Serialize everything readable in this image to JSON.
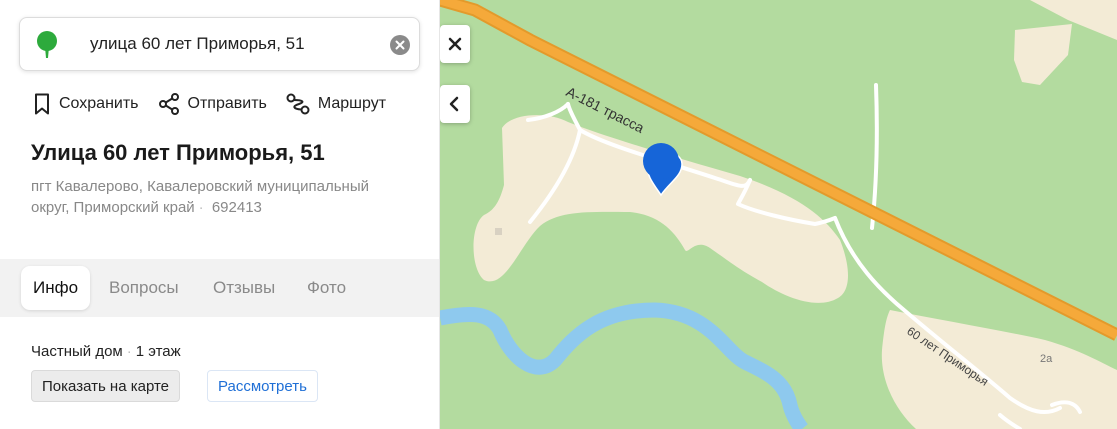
{
  "search": {
    "query": "улица 60 лет Приморья, 51"
  },
  "actions": {
    "save_label": "Сохранить",
    "share_label": "Отправить",
    "route_label": "Маршрут"
  },
  "place": {
    "title": "Улица 60 лет Приморья, 51",
    "address_line": "пгт Кавалерово, Кавалеровский муниципальный округ, Приморский край",
    "postcode": "692413"
  },
  "tabs": [
    {
      "label": "Инфо",
      "active": true
    },
    {
      "label": "Вопросы",
      "active": false
    },
    {
      "label": "Отзывы",
      "active": false
    },
    {
      "label": "Фото",
      "active": false
    }
  ],
  "details": {
    "building_type": "Частный дом",
    "floors": "1 этаж"
  },
  "buttons": {
    "show_on_map": "Показать на карте",
    "look": "Рассмотреть"
  },
  "map": {
    "road_label": "А-181 трасса",
    "street_label": "60 лет Приморья",
    "house_label": "2а"
  },
  "icons": {
    "search_pin": "tree-pin-icon",
    "clear": "clear-icon",
    "save": "bookmark-icon",
    "share": "share-icon",
    "route": "route-icon",
    "close": "close-icon",
    "collapse": "chevron-left-icon",
    "marker": "location-marker-icon"
  },
  "colors": {
    "forest": "#b3db9f",
    "settlement": "#f3ebd6",
    "highway": "#f5a93a",
    "river": "#8ec9ee",
    "marker": "#1665d8",
    "pin_green": "#2daa3c",
    "link": "#1f6fd6"
  }
}
